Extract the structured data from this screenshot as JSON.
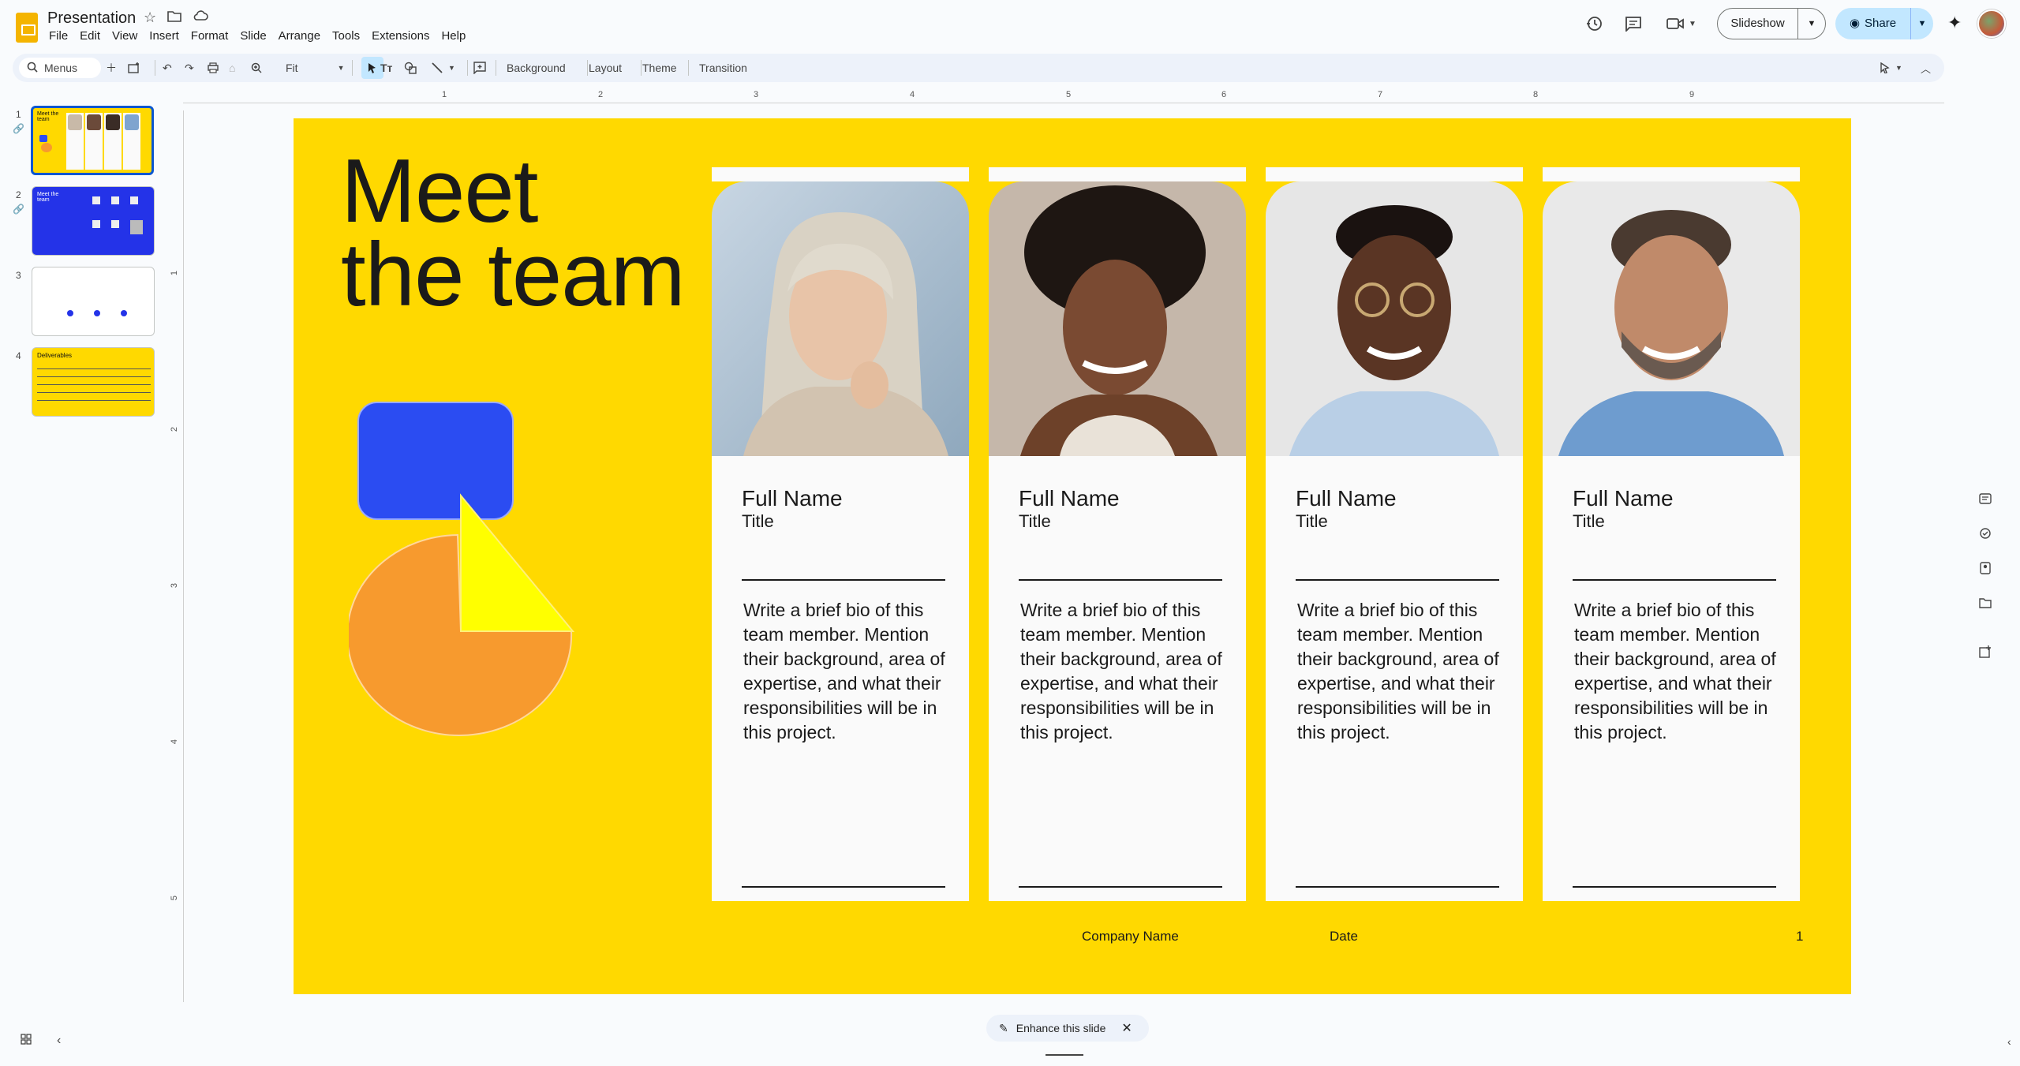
{
  "app": {
    "doc_title": "Presentation",
    "menu": [
      "File",
      "Edit",
      "View",
      "Insert",
      "Format",
      "Slide",
      "Arrange",
      "Tools",
      "Extensions",
      "Help"
    ],
    "slideshow_label": "Slideshow",
    "share_label": "Share"
  },
  "toolbar": {
    "menus_label": "Menus",
    "zoom_label": "Fit",
    "background_label": "Background",
    "layout_label": "Layout",
    "theme_label": "Theme",
    "transition_label": "Transition"
  },
  "ruler": {
    "h_ticks": [
      "1",
      "2",
      "3",
      "4",
      "5",
      "6",
      "7",
      "8",
      "9"
    ],
    "v_ticks": [
      "1",
      "2",
      "3",
      "4",
      "5"
    ]
  },
  "filmstrip": {
    "slides": [
      {
        "num": "1",
        "title": "Meet the team"
      },
      {
        "num": "2",
        "title": "Meet the team"
      },
      {
        "num": "3",
        "title": ""
      },
      {
        "num": "4",
        "title": "Deliverables"
      }
    ]
  },
  "slide": {
    "heading": "Meet the team",
    "heading_line1": "Meet",
    "heading_line2": "the team",
    "members": [
      {
        "name": "Full Name",
        "title": "Title",
        "bio": "Write a brief bio of this team member. Mention their background, area of expertise, and what their responsibilities will be in this project."
      },
      {
        "name": "Full Name",
        "title": "Title",
        "bio": "Write a brief bio of this team member. Mention their background, area of expertise, and what their responsibilities will be in this project."
      },
      {
        "name": "Full Name",
        "title": "Title",
        "bio": "Write a brief bio of this team member. Mention their background, area of expertise, and what their responsibilities will be in this project."
      },
      {
        "name": "Full Name",
        "title": "Title",
        "bio": "Write a brief bio of this team member. Mention their background, area of expertise, and what their responsibilities will be in this project."
      }
    ],
    "footer": {
      "company": "Company Name",
      "date": "Date",
      "page": "1"
    }
  },
  "enhance_label": "Enhance this slide",
  "colors": {
    "slide_bg": "#ffd900",
    "blue_shape": "#2b4cf2",
    "triangle": "#ffff00",
    "pie": "#f79a2e",
    "accent": "#0b57d0",
    "share_bg": "#c2e7ff"
  }
}
